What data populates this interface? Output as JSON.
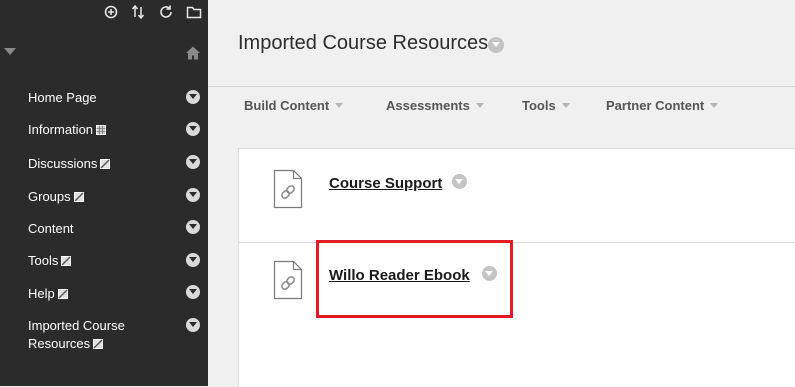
{
  "sidebar": {
    "toolbar_icons": [
      "add-icon",
      "sort-icon",
      "refresh-icon",
      "folder-icon"
    ],
    "items": [
      {
        "label": "Home Page",
        "mark": ""
      },
      {
        "label": "Information",
        "mark": "grid-mark-icon"
      },
      {
        "label": "Discussions",
        "mark": "slash-mark-icon"
      },
      {
        "label": "Groups",
        "mark": "slash-mark-icon"
      },
      {
        "label": "Content",
        "mark": ""
      },
      {
        "label": "Tools",
        "mark": "slash-mark-icon"
      },
      {
        "label": "Help",
        "mark": "slash-mark-icon"
      },
      {
        "label_line1": "Imported Course",
        "label_line2": "Resources",
        "mark": "slash-mark-icon"
      }
    ]
  },
  "header": {
    "title": "Imported Course Resources"
  },
  "actions": [
    {
      "label": "Build Content"
    },
    {
      "label": "Assessments"
    },
    {
      "label": "Tools"
    },
    {
      "label": "Partner Content"
    }
  ],
  "content_items": [
    {
      "title": "Course Support"
    },
    {
      "title": "Willo Reader Ebook"
    }
  ],
  "colors": {
    "sidebar_bg": "#2b2b2b",
    "page_bg": "#f0f0f0",
    "highlight": "#e31b23"
  }
}
